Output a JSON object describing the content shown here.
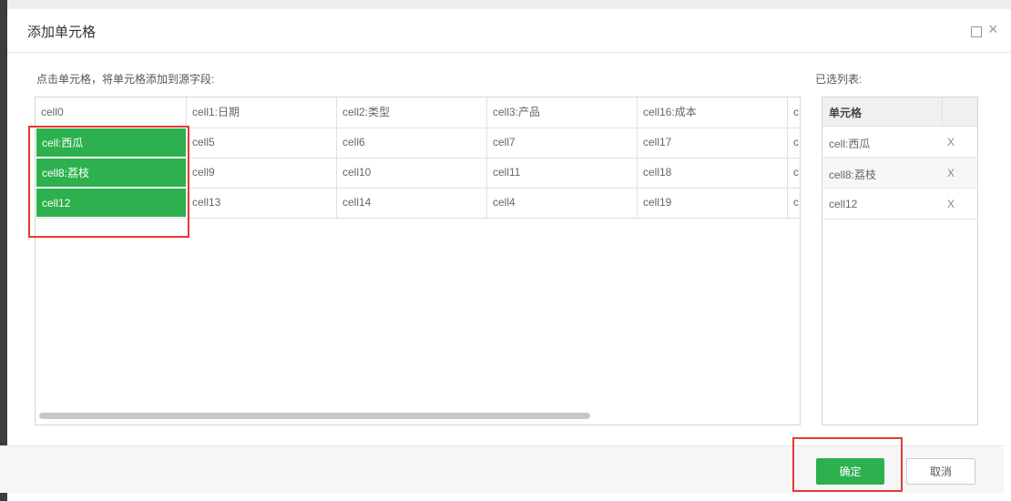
{
  "dialog": {
    "title": "添加单元格",
    "maximize_icon": "maximize-icon",
    "close_icon": "close-icon",
    "close_glyph": "×"
  },
  "instruction": "点击单元格，将单元格添加到源字段:",
  "selected_list_label": "已选列表:",
  "grid": {
    "rows": [
      [
        "cell0",
        "cell1:日期",
        "cell2:类型",
        "cell3:产品",
        "cell16:成本",
        "c"
      ],
      [
        "cell:西瓜",
        "cell5",
        "cell6",
        "cell7",
        "cell17",
        "c"
      ],
      [
        "cell8:荔枝",
        "cell9",
        "cell10",
        "cell11",
        "cell18",
        "c"
      ],
      [
        "cell12",
        "cell13",
        "cell14",
        "cell4",
        "cell19",
        "c"
      ]
    ],
    "selected_cells": [
      "cell:西瓜",
      "cell8:荔枝",
      "cell12"
    ]
  },
  "selected_list": {
    "header": "单元格",
    "items": [
      {
        "name": "cell:西瓜",
        "remove": "X"
      },
      {
        "name": "cell8:荔枝",
        "remove": "X"
      },
      {
        "name": "cell12",
        "remove": "X"
      }
    ]
  },
  "buttons": {
    "ok": "确定",
    "cancel": "取消"
  },
  "colors": {
    "accent_green": "#2db04e",
    "highlight_red": "#e53935"
  }
}
